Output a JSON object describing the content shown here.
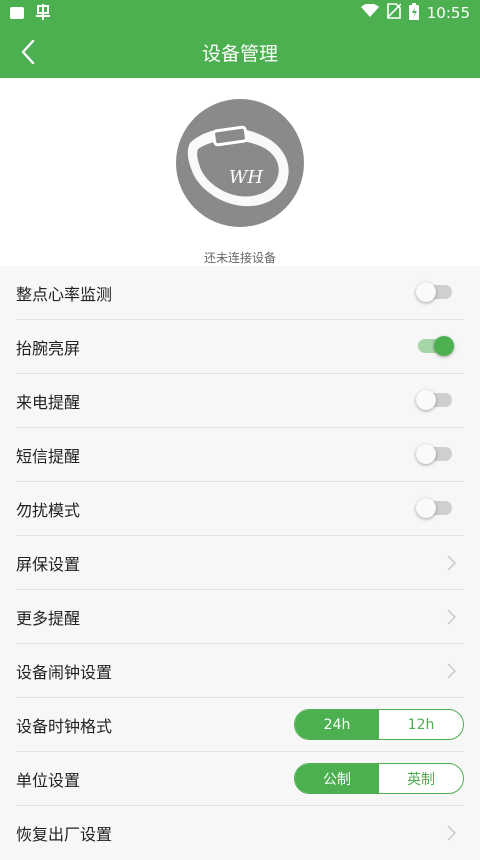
{
  "status_bar": {
    "time": "10:55",
    "left_icons": [
      "notification-icon",
      "app-icon"
    ],
    "right_icons": [
      "wifi-icon",
      "no-sim-icon",
      "battery-charging-icon"
    ]
  },
  "header": {
    "title": "设备管理",
    "back_icon": "back-arrow-icon"
  },
  "device": {
    "image_text": "WH",
    "status": "还未连接设备"
  },
  "settings": [
    {
      "label": "整点心率监测",
      "type": "toggle",
      "on": false
    },
    {
      "label": "抬腕亮屏",
      "type": "toggle",
      "on": true
    },
    {
      "label": "来电提醒",
      "type": "toggle",
      "on": false
    },
    {
      "label": "短信提醒",
      "type": "toggle",
      "on": false
    },
    {
      "label": "勿扰模式",
      "type": "toggle",
      "on": false
    },
    {
      "label": "屏保设置",
      "type": "link"
    },
    {
      "label": "更多提醒",
      "type": "link"
    },
    {
      "label": "设备闹钟设置",
      "type": "link"
    },
    {
      "label": "设备时钟格式",
      "type": "segmented",
      "options": [
        "24h",
        "12h"
      ],
      "selected": 0
    },
    {
      "label": "单位设置",
      "type": "segmented",
      "options": [
        "公制",
        "英制"
      ],
      "selected": 0
    },
    {
      "label": "恢复出厂设置",
      "type": "link"
    }
  ],
  "colors": {
    "accent": "#4caf50",
    "accent_light": "#a5d6a7",
    "toggle_off_track": "#cfcfcf",
    "device_gray": "#8a8a8a"
  }
}
